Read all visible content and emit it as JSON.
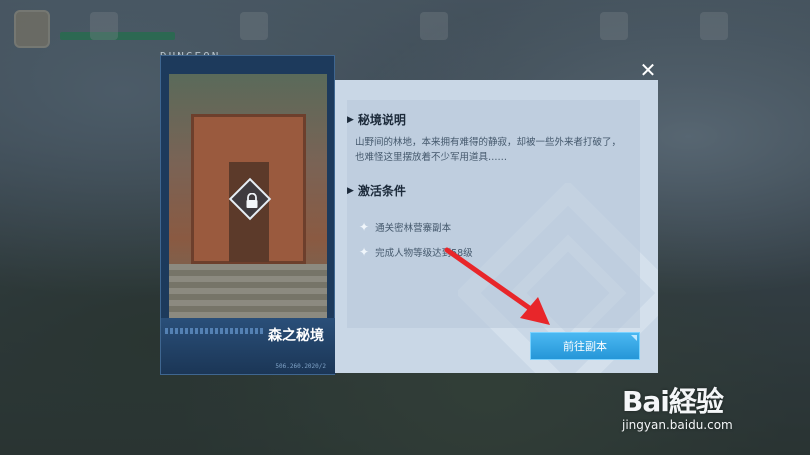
{
  "dialog": {
    "header_label": "DUNGEON",
    "close_label": "✕",
    "card": {
      "title": "森之秘境",
      "code": "506.260.2020/2"
    },
    "description": {
      "heading": "秘境说明",
      "text": "山野间的林地，本来拥有难得的静寂，却被一些外来者打破了，也难怪这里摆放着不少军用道具……"
    },
    "conditions": {
      "heading": "激活条件",
      "items": [
        "通关密林营寨副本",
        "完成人物等级达到58级"
      ]
    },
    "go_button": "前往副本"
  },
  "watermark": {
    "logo_text": "Bai経验",
    "url": "jingyan.baidu.com"
  },
  "colors": {
    "accent": "#2596d8",
    "annotation": "#e8262a"
  },
  "icons": [
    "lock-icon",
    "close-icon",
    "arrow-right-icon",
    "star-icon"
  ]
}
